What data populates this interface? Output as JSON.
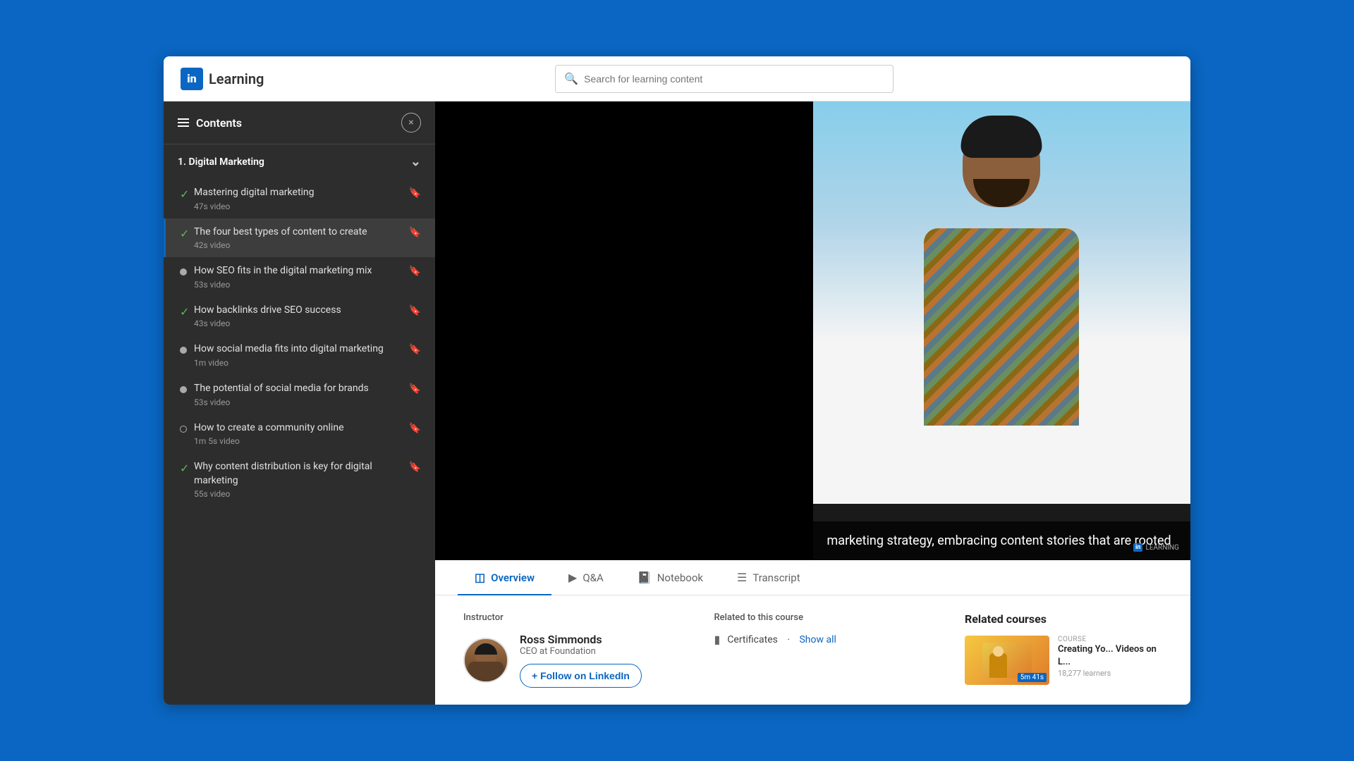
{
  "header": {
    "logo_text": "in",
    "app_name": "Learning",
    "search_placeholder": "Search for learning content"
  },
  "sidebar": {
    "title": "Contents",
    "close_label": "×",
    "section": {
      "number": "1.",
      "name": "Digital Marketing"
    },
    "items": [
      {
        "id": "item-1",
        "status": "completed",
        "title": "Mastering digital marketing",
        "duration": "47s video",
        "bookmarked": false
      },
      {
        "id": "item-2",
        "status": "completed",
        "title": "The four best types of content to create",
        "duration": "42s video",
        "bookmarked": false
      },
      {
        "id": "item-3",
        "status": "active",
        "title": "How SEO fits in the digital marketing mix",
        "duration": "53s video",
        "bookmarked": false
      },
      {
        "id": "item-4",
        "status": "completed",
        "title": "How backlinks drive SEO success",
        "duration": "43s video",
        "bookmarked": false
      },
      {
        "id": "item-5",
        "status": "incomplete",
        "title": "How social media fits into digital marketing",
        "duration": "1m video",
        "bookmarked": false
      },
      {
        "id": "item-6",
        "status": "incomplete",
        "title": "The potential of social media for brands",
        "duration": "53s video",
        "bookmarked": false
      },
      {
        "id": "item-7",
        "status": "empty",
        "title": "How to create a community online",
        "duration": "1m 5s video",
        "bookmarked": false
      },
      {
        "id": "item-8",
        "status": "completed",
        "title": "Why content distribution is key for digital marketing",
        "duration": "55s video",
        "bookmarked": false
      }
    ]
  },
  "video": {
    "caption": "marketing strategy, embracing content stories that are rooted",
    "watermark": "Linked in LEARNING"
  },
  "tabs": [
    {
      "id": "overview",
      "label": "Overview",
      "icon": "grid-icon",
      "active": true
    },
    {
      "id": "qa",
      "label": "Q&A",
      "icon": "send-icon",
      "active": false
    },
    {
      "id": "notebook",
      "label": "Notebook",
      "icon": "notebook-icon",
      "active": false
    },
    {
      "id": "transcript",
      "label": "Transcript",
      "icon": "list-icon",
      "active": false
    }
  ],
  "instructor": {
    "section_label": "Instructor",
    "name": "Ross Simmonds",
    "title": "CEO at Foundation",
    "follow_label": "+ Follow on LinkedIn"
  },
  "related": {
    "section_label": "Related to this course",
    "items": [
      {
        "label": "Certificates",
        "link": "Show all"
      }
    ]
  },
  "related_courses": {
    "title": "Related courses",
    "items": [
      {
        "label": "COURSE",
        "title": "Creating Yo... Videos on L...",
        "duration": "5m 41s",
        "learners": "18,277 learners"
      }
    ]
  }
}
